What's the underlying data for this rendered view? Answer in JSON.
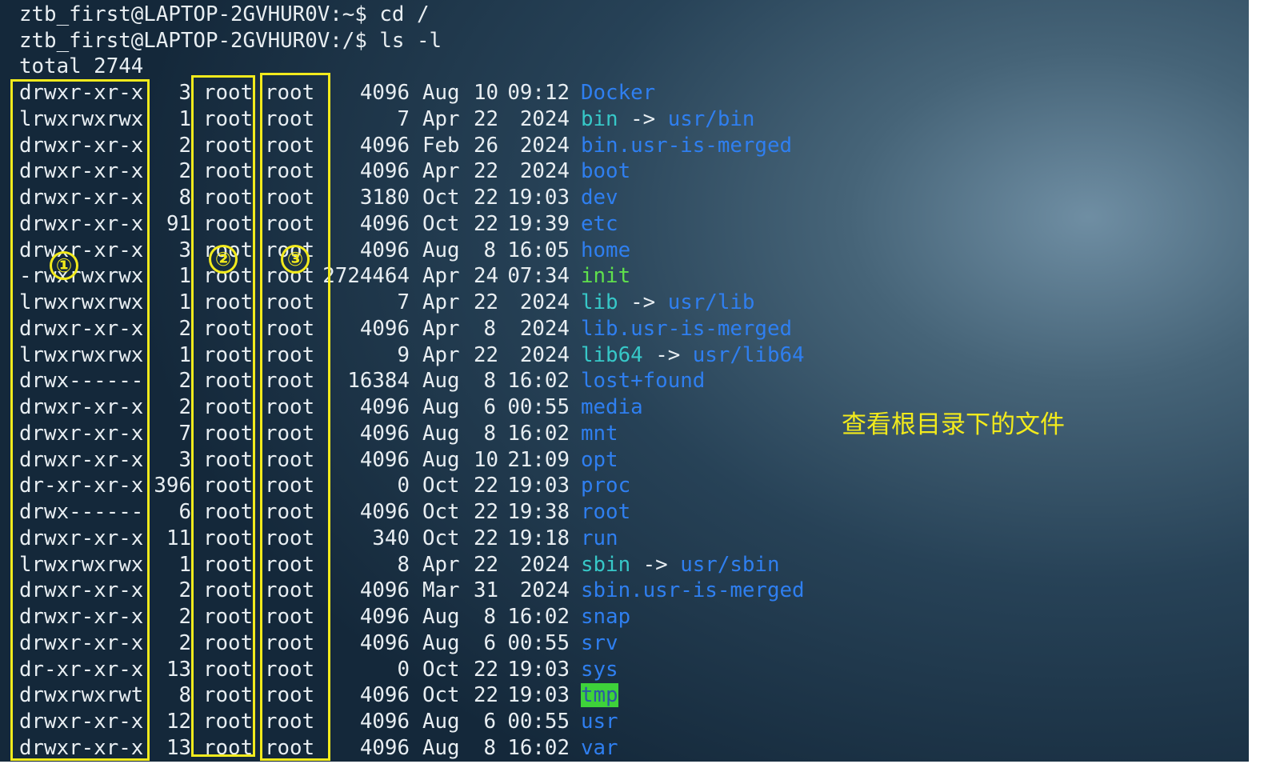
{
  "terminal": {
    "prompt_lines": [
      "ztb_first@LAPTOP-2GVHUR0V:~$ cd /",
      "ztb_first@LAPTOP-2GVHUR0V:/$ ls -l"
    ],
    "total_line": "total 2744",
    "entries": [
      {
        "perm": "drwxr-xr-x",
        "links": "3",
        "owner": "root",
        "group": "root",
        "size": "4096",
        "month": "Aug",
        "day": "10",
        "time": "09:12",
        "name": "Docker",
        "kind": "dir",
        "target": ""
      },
      {
        "perm": "lrwxrwxrwx",
        "links": "1",
        "owner": "root",
        "group": "root",
        "size": "7",
        "month": "Apr",
        "day": "22",
        "time": "2024",
        "name": "bin",
        "kind": "link",
        "target": "usr/bin"
      },
      {
        "perm": "drwxr-xr-x",
        "links": "2",
        "owner": "root",
        "group": "root",
        "size": "4096",
        "month": "Feb",
        "day": "26",
        "time": "2024",
        "name": "bin.usr-is-merged",
        "kind": "dir",
        "target": ""
      },
      {
        "perm": "drwxr-xr-x",
        "links": "2",
        "owner": "root",
        "group": "root",
        "size": "4096",
        "month": "Apr",
        "day": "22",
        "time": "2024",
        "name": "boot",
        "kind": "dir",
        "target": ""
      },
      {
        "perm": "drwxr-xr-x",
        "links": "8",
        "owner": "root",
        "group": "root",
        "size": "3180",
        "month": "Oct",
        "day": "22",
        "time": "19:03",
        "name": "dev",
        "kind": "dir",
        "target": ""
      },
      {
        "perm": "drwxr-xr-x",
        "links": "91",
        "owner": "root",
        "group": "root",
        "size": "4096",
        "month": "Oct",
        "day": "22",
        "time": "19:39",
        "name": "etc",
        "kind": "dir",
        "target": ""
      },
      {
        "perm": "drwxr-xr-x",
        "links": "3",
        "owner": "root",
        "group": "root",
        "size": "4096",
        "month": "Aug",
        "day": "8",
        "time": "16:05",
        "name": "home",
        "kind": "dir",
        "target": ""
      },
      {
        "perm": "-rwxrwxrwx",
        "links": "1",
        "owner": "root",
        "group": "root",
        "size": "2724464",
        "month": "Apr",
        "day": "24",
        "time": "07:34",
        "name": "init",
        "kind": "exec",
        "target": ""
      },
      {
        "perm": "lrwxrwxrwx",
        "links": "1",
        "owner": "root",
        "group": "root",
        "size": "7",
        "month": "Apr",
        "day": "22",
        "time": "2024",
        "name": "lib",
        "kind": "link",
        "target": "usr/lib"
      },
      {
        "perm": "drwxr-xr-x",
        "links": "2",
        "owner": "root",
        "group": "root",
        "size": "4096",
        "month": "Apr",
        "day": "8",
        "time": "2024",
        "name": "lib.usr-is-merged",
        "kind": "dir",
        "target": ""
      },
      {
        "perm": "lrwxrwxrwx",
        "links": "1",
        "owner": "root",
        "group": "root",
        "size": "9",
        "month": "Apr",
        "day": "22",
        "time": "2024",
        "name": "lib64",
        "kind": "link",
        "target": "usr/lib64"
      },
      {
        "perm": "drwx------",
        "links": "2",
        "owner": "root",
        "group": "root",
        "size": "16384",
        "month": "Aug",
        "day": "8",
        "time": "16:02",
        "name": "lost+found",
        "kind": "dir",
        "target": ""
      },
      {
        "perm": "drwxr-xr-x",
        "links": "2",
        "owner": "root",
        "group": "root",
        "size": "4096",
        "month": "Aug",
        "day": "6",
        "time": "00:55",
        "name": "media",
        "kind": "dir",
        "target": ""
      },
      {
        "perm": "drwxr-xr-x",
        "links": "7",
        "owner": "root",
        "group": "root",
        "size": "4096",
        "month": "Aug",
        "day": "8",
        "time": "16:02",
        "name": "mnt",
        "kind": "dir",
        "target": ""
      },
      {
        "perm": "drwxr-xr-x",
        "links": "3",
        "owner": "root",
        "group": "root",
        "size": "4096",
        "month": "Aug",
        "day": "10",
        "time": "21:09",
        "name": "opt",
        "kind": "dir",
        "target": ""
      },
      {
        "perm": "dr-xr-xr-x",
        "links": "396",
        "owner": "root",
        "group": "root",
        "size": "0",
        "month": "Oct",
        "day": "22",
        "time": "19:03",
        "name": "proc",
        "kind": "dir",
        "target": ""
      },
      {
        "perm": "drwx------",
        "links": "6",
        "owner": "root",
        "group": "root",
        "size": "4096",
        "month": "Oct",
        "day": "22",
        "time": "19:38",
        "name": "root",
        "kind": "dir",
        "target": ""
      },
      {
        "perm": "drwxr-xr-x",
        "links": "11",
        "owner": "root",
        "group": "root",
        "size": "340",
        "month": "Oct",
        "day": "22",
        "time": "19:18",
        "name": "run",
        "kind": "dir",
        "target": ""
      },
      {
        "perm": "lrwxrwxrwx",
        "links": "1",
        "owner": "root",
        "group": "root",
        "size": "8",
        "month": "Apr",
        "day": "22",
        "time": "2024",
        "name": "sbin",
        "kind": "link",
        "target": "usr/sbin"
      },
      {
        "perm": "drwxr-xr-x",
        "links": "2",
        "owner": "root",
        "group": "root",
        "size": "4096",
        "month": "Mar",
        "day": "31",
        "time": "2024",
        "name": "sbin.usr-is-merged",
        "kind": "dir",
        "target": ""
      },
      {
        "perm": "drwxr-xr-x",
        "links": "2",
        "owner": "root",
        "group": "root",
        "size": "4096",
        "month": "Aug",
        "day": "8",
        "time": "16:02",
        "name": "snap",
        "kind": "dir",
        "target": ""
      },
      {
        "perm": "drwxr-xr-x",
        "links": "2",
        "owner": "root",
        "group": "root",
        "size": "4096",
        "month": "Aug",
        "day": "6",
        "time": "00:55",
        "name": "srv",
        "kind": "dir",
        "target": ""
      },
      {
        "perm": "dr-xr-xr-x",
        "links": "13",
        "owner": "root",
        "group": "root",
        "size": "0",
        "month": "Oct",
        "day": "22",
        "time": "19:03",
        "name": "sys",
        "kind": "dir",
        "target": ""
      },
      {
        "perm": "drwxrwxrwt",
        "links": "8",
        "owner": "root",
        "group": "root",
        "size": "4096",
        "month": "Oct",
        "day": "22",
        "time": "19:03",
        "name": "tmp",
        "kind": "sticky",
        "target": ""
      },
      {
        "perm": "drwxr-xr-x",
        "links": "12",
        "owner": "root",
        "group": "root",
        "size": "4096",
        "month": "Aug",
        "day": "6",
        "time": "00:55",
        "name": "usr",
        "kind": "dir",
        "target": ""
      },
      {
        "perm": "drwxr-xr-x",
        "links": "13",
        "owner": "root",
        "group": "root",
        "size": "4096",
        "month": "Aug",
        "day": "8",
        "time": "16:02",
        "name": "var",
        "kind": "dir",
        "target": ""
      }
    ],
    "link_arrow": "->"
  },
  "annotation": {
    "markers": [
      "①",
      "②",
      "③"
    ],
    "note": "查看根目录下的文件",
    "color": "#f2ea1c"
  },
  "colors": {
    "dir": "#2f7ff0",
    "link": "#37c8c8",
    "exec": "#5fe04c",
    "sticky_bg": "#3ed23a",
    "text": "#e8eef2"
  }
}
